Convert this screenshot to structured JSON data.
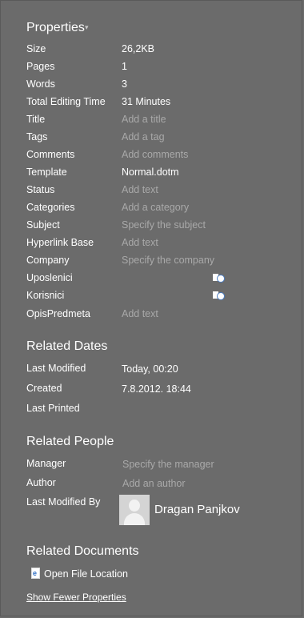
{
  "properties": {
    "title": "Properties",
    "rows": [
      {
        "label": "Size",
        "value": "26,2KB",
        "placeholder": false
      },
      {
        "label": "Pages",
        "value": "1",
        "placeholder": false
      },
      {
        "label": "Words",
        "value": "3",
        "placeholder": false
      },
      {
        "label": "Total Editing Time",
        "value": "31 Minutes",
        "placeholder": false
      },
      {
        "label": "Title",
        "value": "Add a title",
        "placeholder": true
      },
      {
        "label": "Tags",
        "value": "Add a tag",
        "placeholder": true
      },
      {
        "label": "Comments",
        "value": "Add comments",
        "placeholder": true
      },
      {
        "label": "Template",
        "value": "Normal.dotm",
        "placeholder": false
      },
      {
        "label": "Status",
        "value": "Add text",
        "placeholder": true
      },
      {
        "label": "Categories",
        "value": "Add a category",
        "placeholder": true
      },
      {
        "label": "Subject",
        "value": "Specify the subject",
        "placeholder": true
      },
      {
        "label": "Hyperlink Base",
        "value": "Add text",
        "placeholder": true
      },
      {
        "label": "Company",
        "value": "Specify the company",
        "placeholder": true
      },
      {
        "label": "Uposlenici",
        "value": "",
        "placeholder": false
      },
      {
        "label": "Korisnici",
        "value": "",
        "placeholder": false
      },
      {
        "label": "OpisPredmeta",
        "value": "Add text",
        "placeholder": true
      }
    ]
  },
  "related_dates": {
    "title": "Related Dates",
    "rows": [
      {
        "label": "Last Modified",
        "value": "Today, 00:20"
      },
      {
        "label": "Created",
        "value": "7.8.2012. 18:44"
      },
      {
        "label": "Last Printed",
        "value": ""
      }
    ]
  },
  "related_people": {
    "title": "Related People",
    "manager_label": "Manager",
    "manager_placeholder": "Specify the manager",
    "author_label": "Author",
    "author_placeholder": "Add an author",
    "last_modified_by_label": "Last Modified By",
    "last_modified_by_name": "Dragan Panjkov"
  },
  "related_documents": {
    "title": "Related Documents",
    "open_file_location": "Open File Location"
  },
  "show_fewer": "Show Fewer Properties",
  "colors": {
    "background": "#6b6b6b",
    "text": "#ffffff",
    "placeholder": "#a9a9a9",
    "file_icon_accent": "#2b6cc4"
  }
}
